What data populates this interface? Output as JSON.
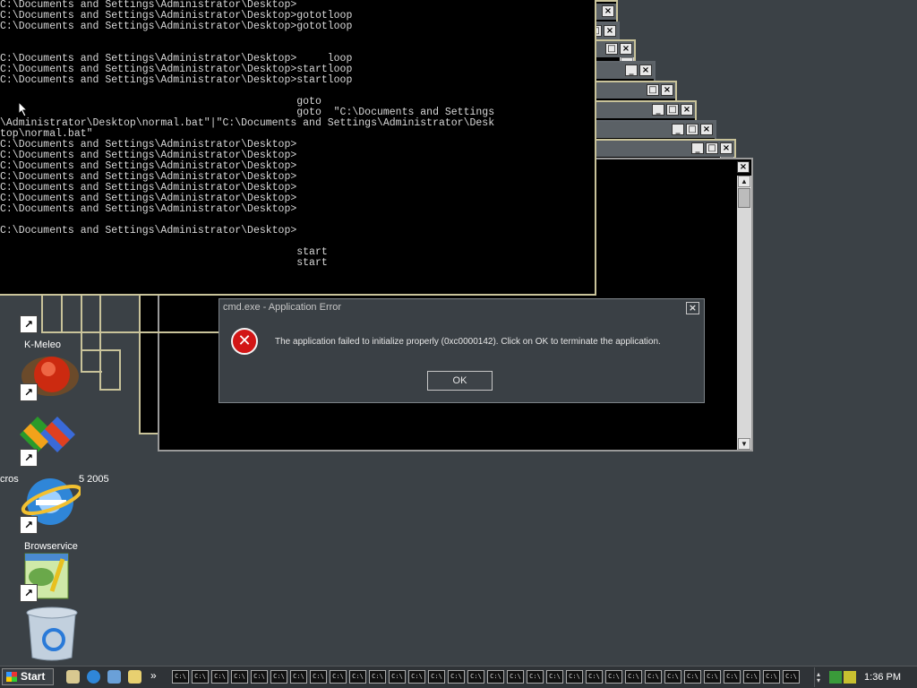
{
  "console": {
    "lines": [
      "C:\\Documents and Settings\\Administrator\\Desktop>",
      "C:\\Documents and Settings\\Administrator\\Desktop>gototloop",
      "C:\\Documents and Settings\\Administrator\\Desktop>gototloop",
      "",
      "",
      "C:\\Documents and Settings\\Administrator\\Desktop>     loop",
      "C:\\Documents and Settings\\Administrator\\Desktop>startloop",
      "C:\\Documents and Settings\\Administrator\\Desktop>startloop",
      "",
      "                                                goto",
      "                                                goto  \"C:\\Documents and Settings",
      "\\Administrator\\Desktop\\normal.bat\"|\"C:\\Documents and Settings\\Administrator\\Desk",
      "top\\normal.bat\"",
      "C:\\Documents and Settings\\Administrator\\Desktop>",
      "C:\\Documents and Settings\\Administrator\\Desktop>",
      "C:\\Documents and Settings\\Administrator\\Desktop>",
      "C:\\Documents and Settings\\Administrator\\Desktop>",
      "C:\\Documents and Settings\\Administrator\\Desktop>",
      "C:\\Documents and Settings\\Administrator\\Desktop>",
      "C:\\Documents and Settings\\Administrator\\Desktop>",
      "",
      "C:\\Documents and Settings\\Administrator\\Desktop>",
      "",
      "                                                start",
      "                                                start"
    ]
  },
  "window_buttons": {
    "minimize": "_",
    "maximize": "□",
    "close": "×",
    "scroll_up": "▲",
    "scroll_down": "▼"
  },
  "dialog": {
    "title": "cmd.exe - Application Error",
    "message": "The application failed to initialize properly (0xc0000142). Click on OK to terminate the application.",
    "ok_label": "OK",
    "close_glyph": "×",
    "icon": "error-icon",
    "error_glyph": "✕"
  },
  "desktop_icons": [
    {
      "label": "K-Meleo",
      "icon": "kmeleon-icon"
    },
    {
      "label": "cros",
      "icon": "vs-icon"
    },
    {
      "label": "5 2005",
      "icon": "vs-icon"
    },
    {
      "label": "Browservice",
      "icon": "ie-icon"
    },
    {
      "label": "",
      "icon": "notepad-icon"
    },
    {
      "label": "",
      "icon": "recycle-bin-icon"
    }
  ],
  "shortcut_glyph": "↗",
  "taskbar": {
    "start_label": "Start",
    "quicklaunch_more": "»",
    "task_label": "C:\\",
    "task_count": 35,
    "clock": "1:36 PM"
  },
  "colors": {
    "desktop": "#3b4146",
    "console_border": "#c9c39a",
    "error_red": "#d21616"
  }
}
